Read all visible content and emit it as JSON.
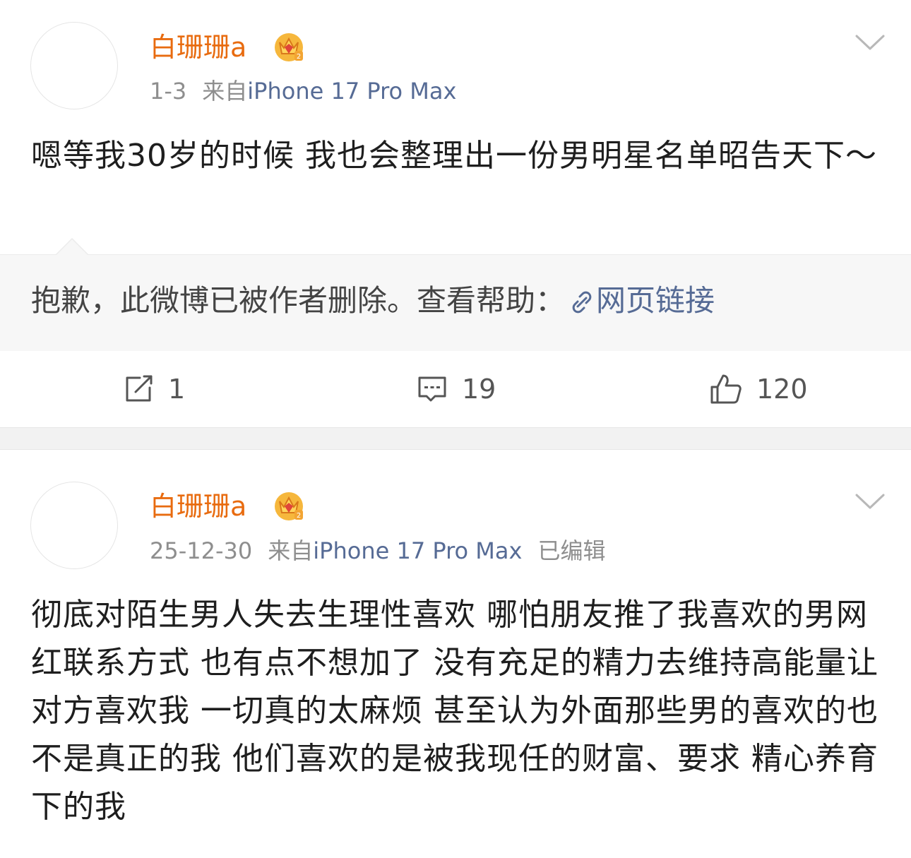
{
  "posts": [
    {
      "author": "白珊珊a",
      "crown_icon": "vip-crown-icon",
      "date": "1-3",
      "source_prefix": "来自",
      "source": "iPhone 17 Pro Max",
      "edited": "",
      "text": "嗯等我30岁的时候 我也会整理出一份男明星名单昭告天下～",
      "retweet": {
        "message": "抱歉，此微博已被作者删除。查看帮助：",
        "link_label": "网页链接",
        "link_icon": "link-icon"
      },
      "actions": {
        "repost_count": "1",
        "comment_count": "19",
        "like_count": "120"
      }
    },
    {
      "author": "白珊珊a",
      "crown_icon": "vip-crown-icon",
      "date": "25-12-30",
      "source_prefix": "来自",
      "source": "iPhone 17 Pro Max",
      "edited": "已编辑",
      "text": "彻底对陌生男人失去生理性喜欢 哪怕朋友推了我喜欢的男网红联系方式 也有点不想加了 没有充足的精力去维持高能量让对方喜欢我 一切真的太麻烦 甚至认为外面那些男的喜欢的也不是真正的我 他们喜欢的是被我现任的财富、要求 精心养育下的我"
    }
  ],
  "colors": {
    "author": "#e86b0f",
    "source_link": "#566b95",
    "meta": "#8e8e8e",
    "retweet_bg": "#f7f7f7"
  }
}
